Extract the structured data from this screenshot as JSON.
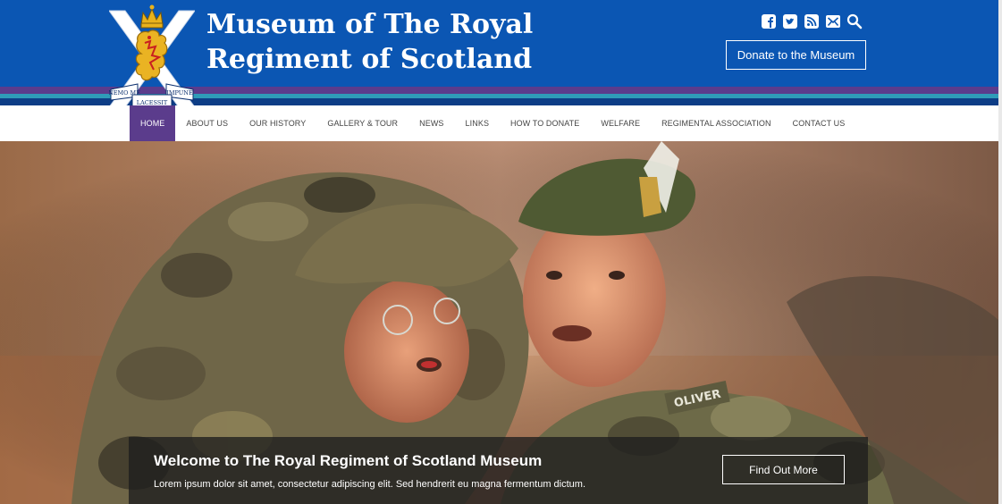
{
  "header": {
    "title_line1": "Museum of The Royal",
    "title_line2": "Regiment of Scotland",
    "logo_motto_left": "NEMO ME",
    "logo_motto_right": "IMPUNE",
    "logo_motto_bottom": "LACESSIT",
    "donate_label": "Donate to the Museum",
    "social_icons": [
      "facebook-icon",
      "twitter-icon",
      "rss-icon",
      "email-icon",
      "search-icon"
    ]
  },
  "nav": {
    "items": [
      {
        "label": "HOME",
        "active": true
      },
      {
        "label": "ABOUT US"
      },
      {
        "label": "OUR HISTORY"
      },
      {
        "label": "GALLERY & TOUR"
      },
      {
        "label": "NEWS"
      },
      {
        "label": "LINKS"
      },
      {
        "label": "HOW TO DONATE"
      },
      {
        "label": "WELFARE"
      },
      {
        "label": "REGIMENTAL ASSOCIATION"
      },
      {
        "label": "CONTACT US"
      }
    ]
  },
  "hero": {
    "name_tape": "OLIVER",
    "title": "Welcome to The Royal Regiment of Scotland Museum",
    "text": "Lorem ipsum dolor sit amet, consectetur adipiscing elit. Sed hendrerit eu magna fermentum dictum.",
    "button_label": "Find Out More"
  },
  "colors": {
    "header_blue": "#0b56b3",
    "nav_active_purple": "#5b3c8c",
    "stripe_teal": "#2f9bb8",
    "stripe_navy": "#0d3d86"
  }
}
